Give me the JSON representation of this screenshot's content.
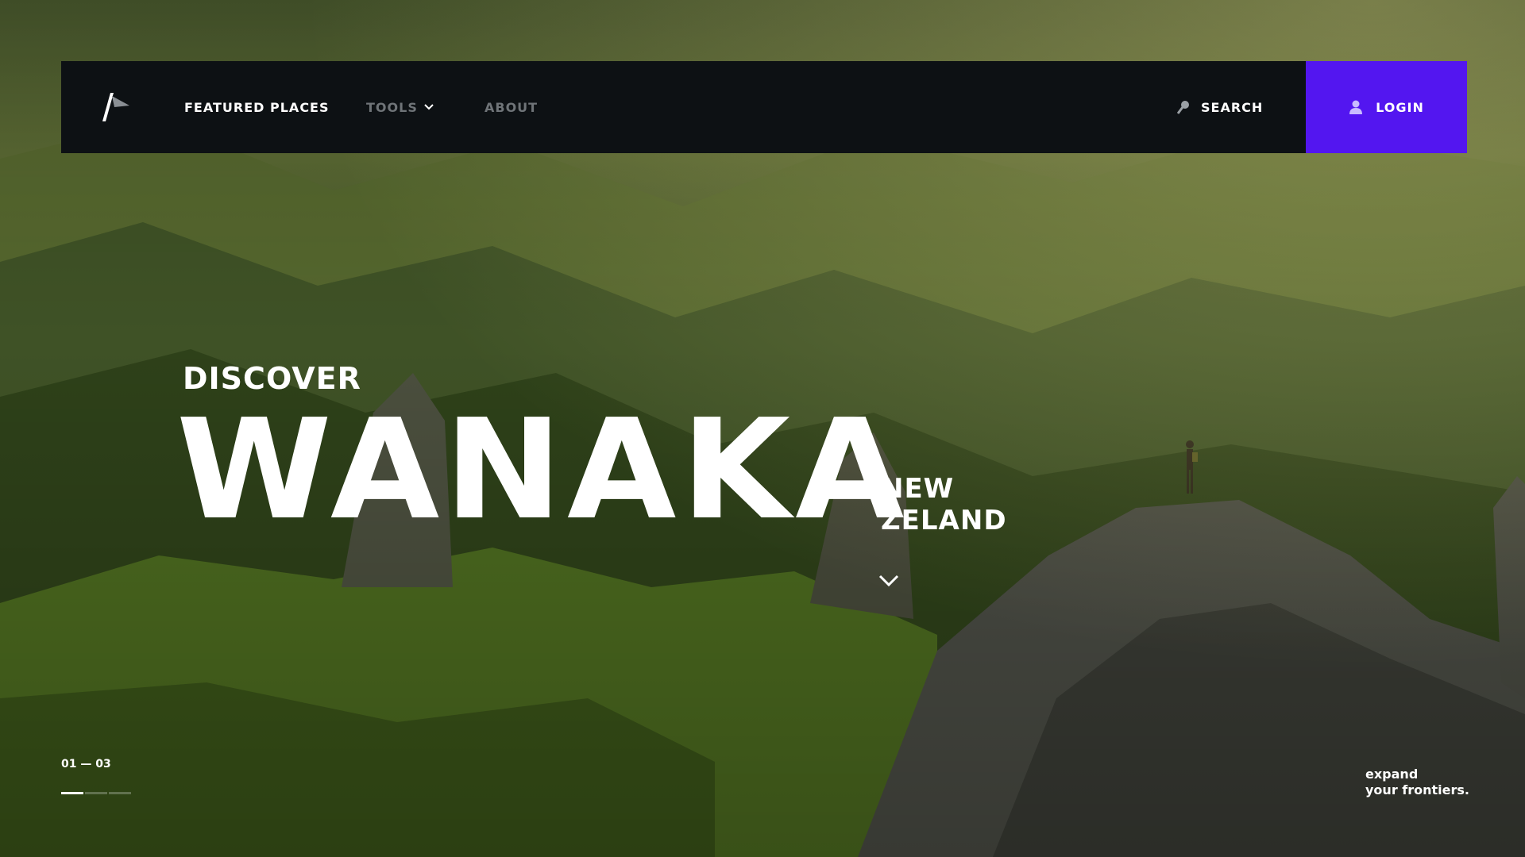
{
  "nav": {
    "logo_icon": "arrow-flag-logo-icon",
    "featured_label": "FEATURED PLACES",
    "tools_label": "TOOLS",
    "about_label": "ABOUT",
    "search_label": "SEARCH",
    "search_icon": "search-icon",
    "login_label": "LOGIN",
    "login_icon": "user-icon"
  },
  "hero": {
    "eyebrow": "DISCOVER",
    "title": "WANAKA",
    "country_line1": "NEW",
    "country_line2": "ZELAND",
    "scroll_icon": "chevron-down-icon"
  },
  "slider": {
    "counter": "01 — 03",
    "current": 1,
    "total": 3
  },
  "tagline": {
    "line1": "expand",
    "line2": "your frontiers."
  },
  "colors": {
    "navbar_bg": "#0d1114",
    "accent": "#5316f0",
    "nav_active": "#ffffff",
    "nav_muted": "#6f7478"
  }
}
